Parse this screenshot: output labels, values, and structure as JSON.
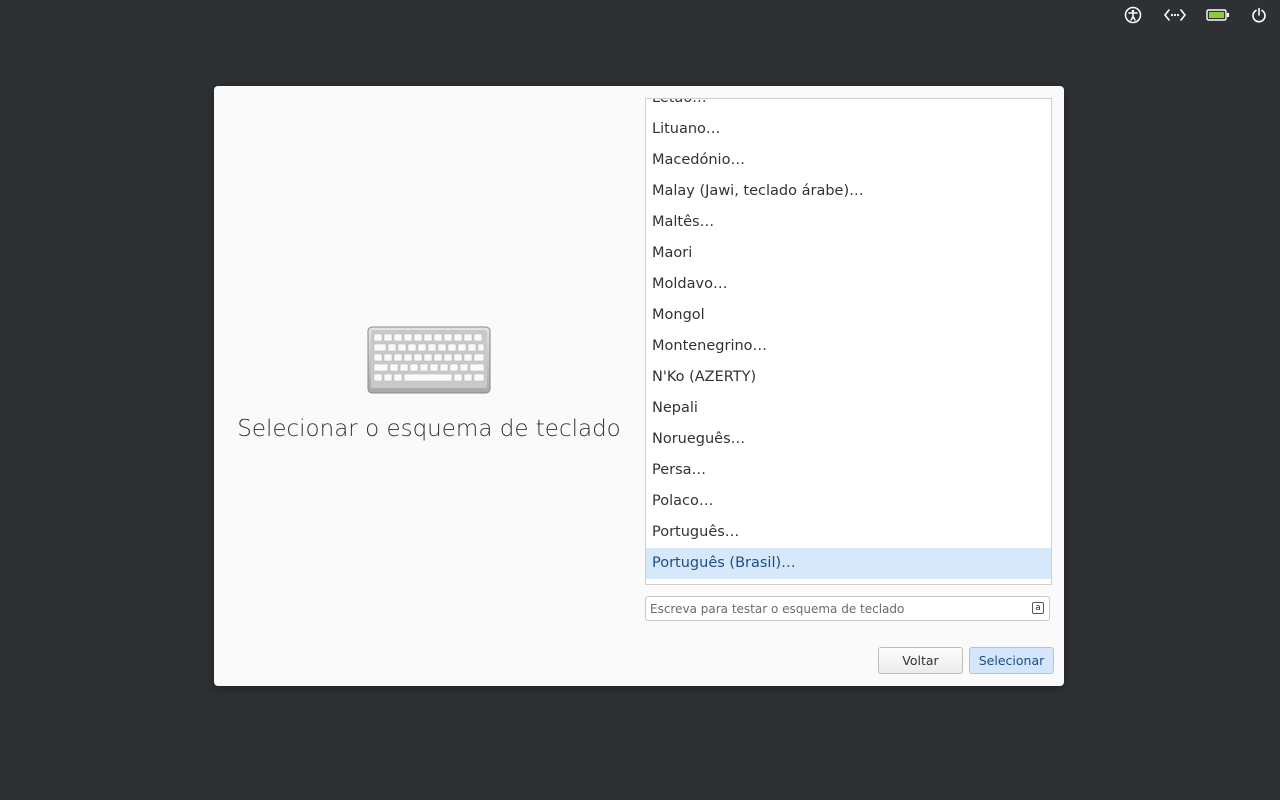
{
  "topbar": {
    "icons": [
      "accessibility-icon",
      "network-wired-icon",
      "battery-icon",
      "power-icon"
    ],
    "battery_color": "#8fcc3c"
  },
  "dialog": {
    "title": "Selecionar o esquema de teclado",
    "layouts": [
      "Letão…",
      "Lituano…",
      "Macedónio…",
      "Malay (Jawi, teclado árabe)…",
      "Maltês…",
      "Maori",
      "Moldavo…",
      "Mongol",
      "Montenegrino…",
      "N'Ko (AZERTY)",
      "Nepali",
      "Norueguês…",
      "Persa…",
      "Polaco…",
      "Português…",
      "Português (Brasil)…"
    ],
    "selected_layout": "Português (Brasil)…",
    "test_placeholder": "Escreva para testar o esquema de teclado",
    "test_value": "",
    "back_label": "Voltar",
    "select_label": "Selecionar"
  },
  "colors": {
    "background": "#2d3134",
    "selection": "#d6e8fa",
    "accent_text": "#1c4f85"
  }
}
